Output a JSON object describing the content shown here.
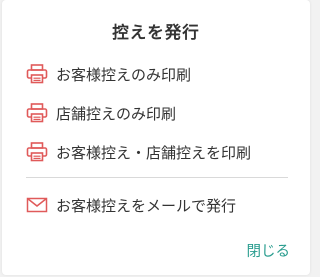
{
  "dialog": {
    "title": "控えを発行",
    "options": [
      {
        "label": "お客様控えのみ印刷",
        "icon": "printer-icon"
      },
      {
        "label": "店舗控えのみ印刷",
        "icon": "printer-icon"
      },
      {
        "label": "お客様控え・店舗控えを印刷",
        "icon": "printer-icon"
      },
      {
        "label": "お客様控えをメールで発行",
        "icon": "envelope-icon"
      }
    ],
    "close_label": "閉じる"
  },
  "colors": {
    "icon_red": "#e05a5a",
    "close_teal": "#2a9d8f",
    "text": "#333333"
  }
}
